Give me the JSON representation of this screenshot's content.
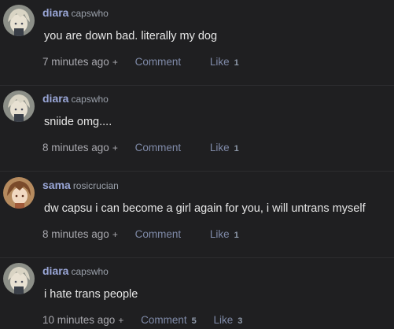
{
  "comments": [
    {
      "username": "diara",
      "handle": "capswho",
      "text": "you are down bad. literally my dog",
      "time": "7 minutes ago",
      "plus": "+",
      "comment_label": "Comment",
      "comment_count": "",
      "like_label": "Like",
      "like_count": "1",
      "avatar": "blonde-character-avatar"
    },
    {
      "username": "diara",
      "handle": "capswho",
      "text": "sniide omg....",
      "time": "8 minutes ago",
      "plus": "+",
      "comment_label": "Comment",
      "comment_count": "",
      "like_label": "Like",
      "like_count": "1",
      "avatar": "blonde-character-avatar"
    },
    {
      "username": "sama",
      "handle": "rosicrucian",
      "text": "dw capsu i can become a girl again for you, i will untrans myself",
      "time": "8 minutes ago",
      "plus": "+",
      "comment_label": "Comment",
      "comment_count": "",
      "like_label": "Like",
      "like_count": "1",
      "avatar": "brown-haired-character-avatar"
    },
    {
      "username": "diara",
      "handle": "capswho",
      "text": "i hate trans people",
      "time": "10 minutes ago",
      "plus": "+",
      "comment_label": "Comment",
      "comment_count": "5",
      "like_label": "Like",
      "like_count": "3",
      "avatar": "blonde-character-avatar"
    }
  ],
  "colors": {
    "background": "#1f1f21",
    "username": "#9aa7d8",
    "text": "#e6e6e6",
    "link": "#7f8aa8"
  }
}
